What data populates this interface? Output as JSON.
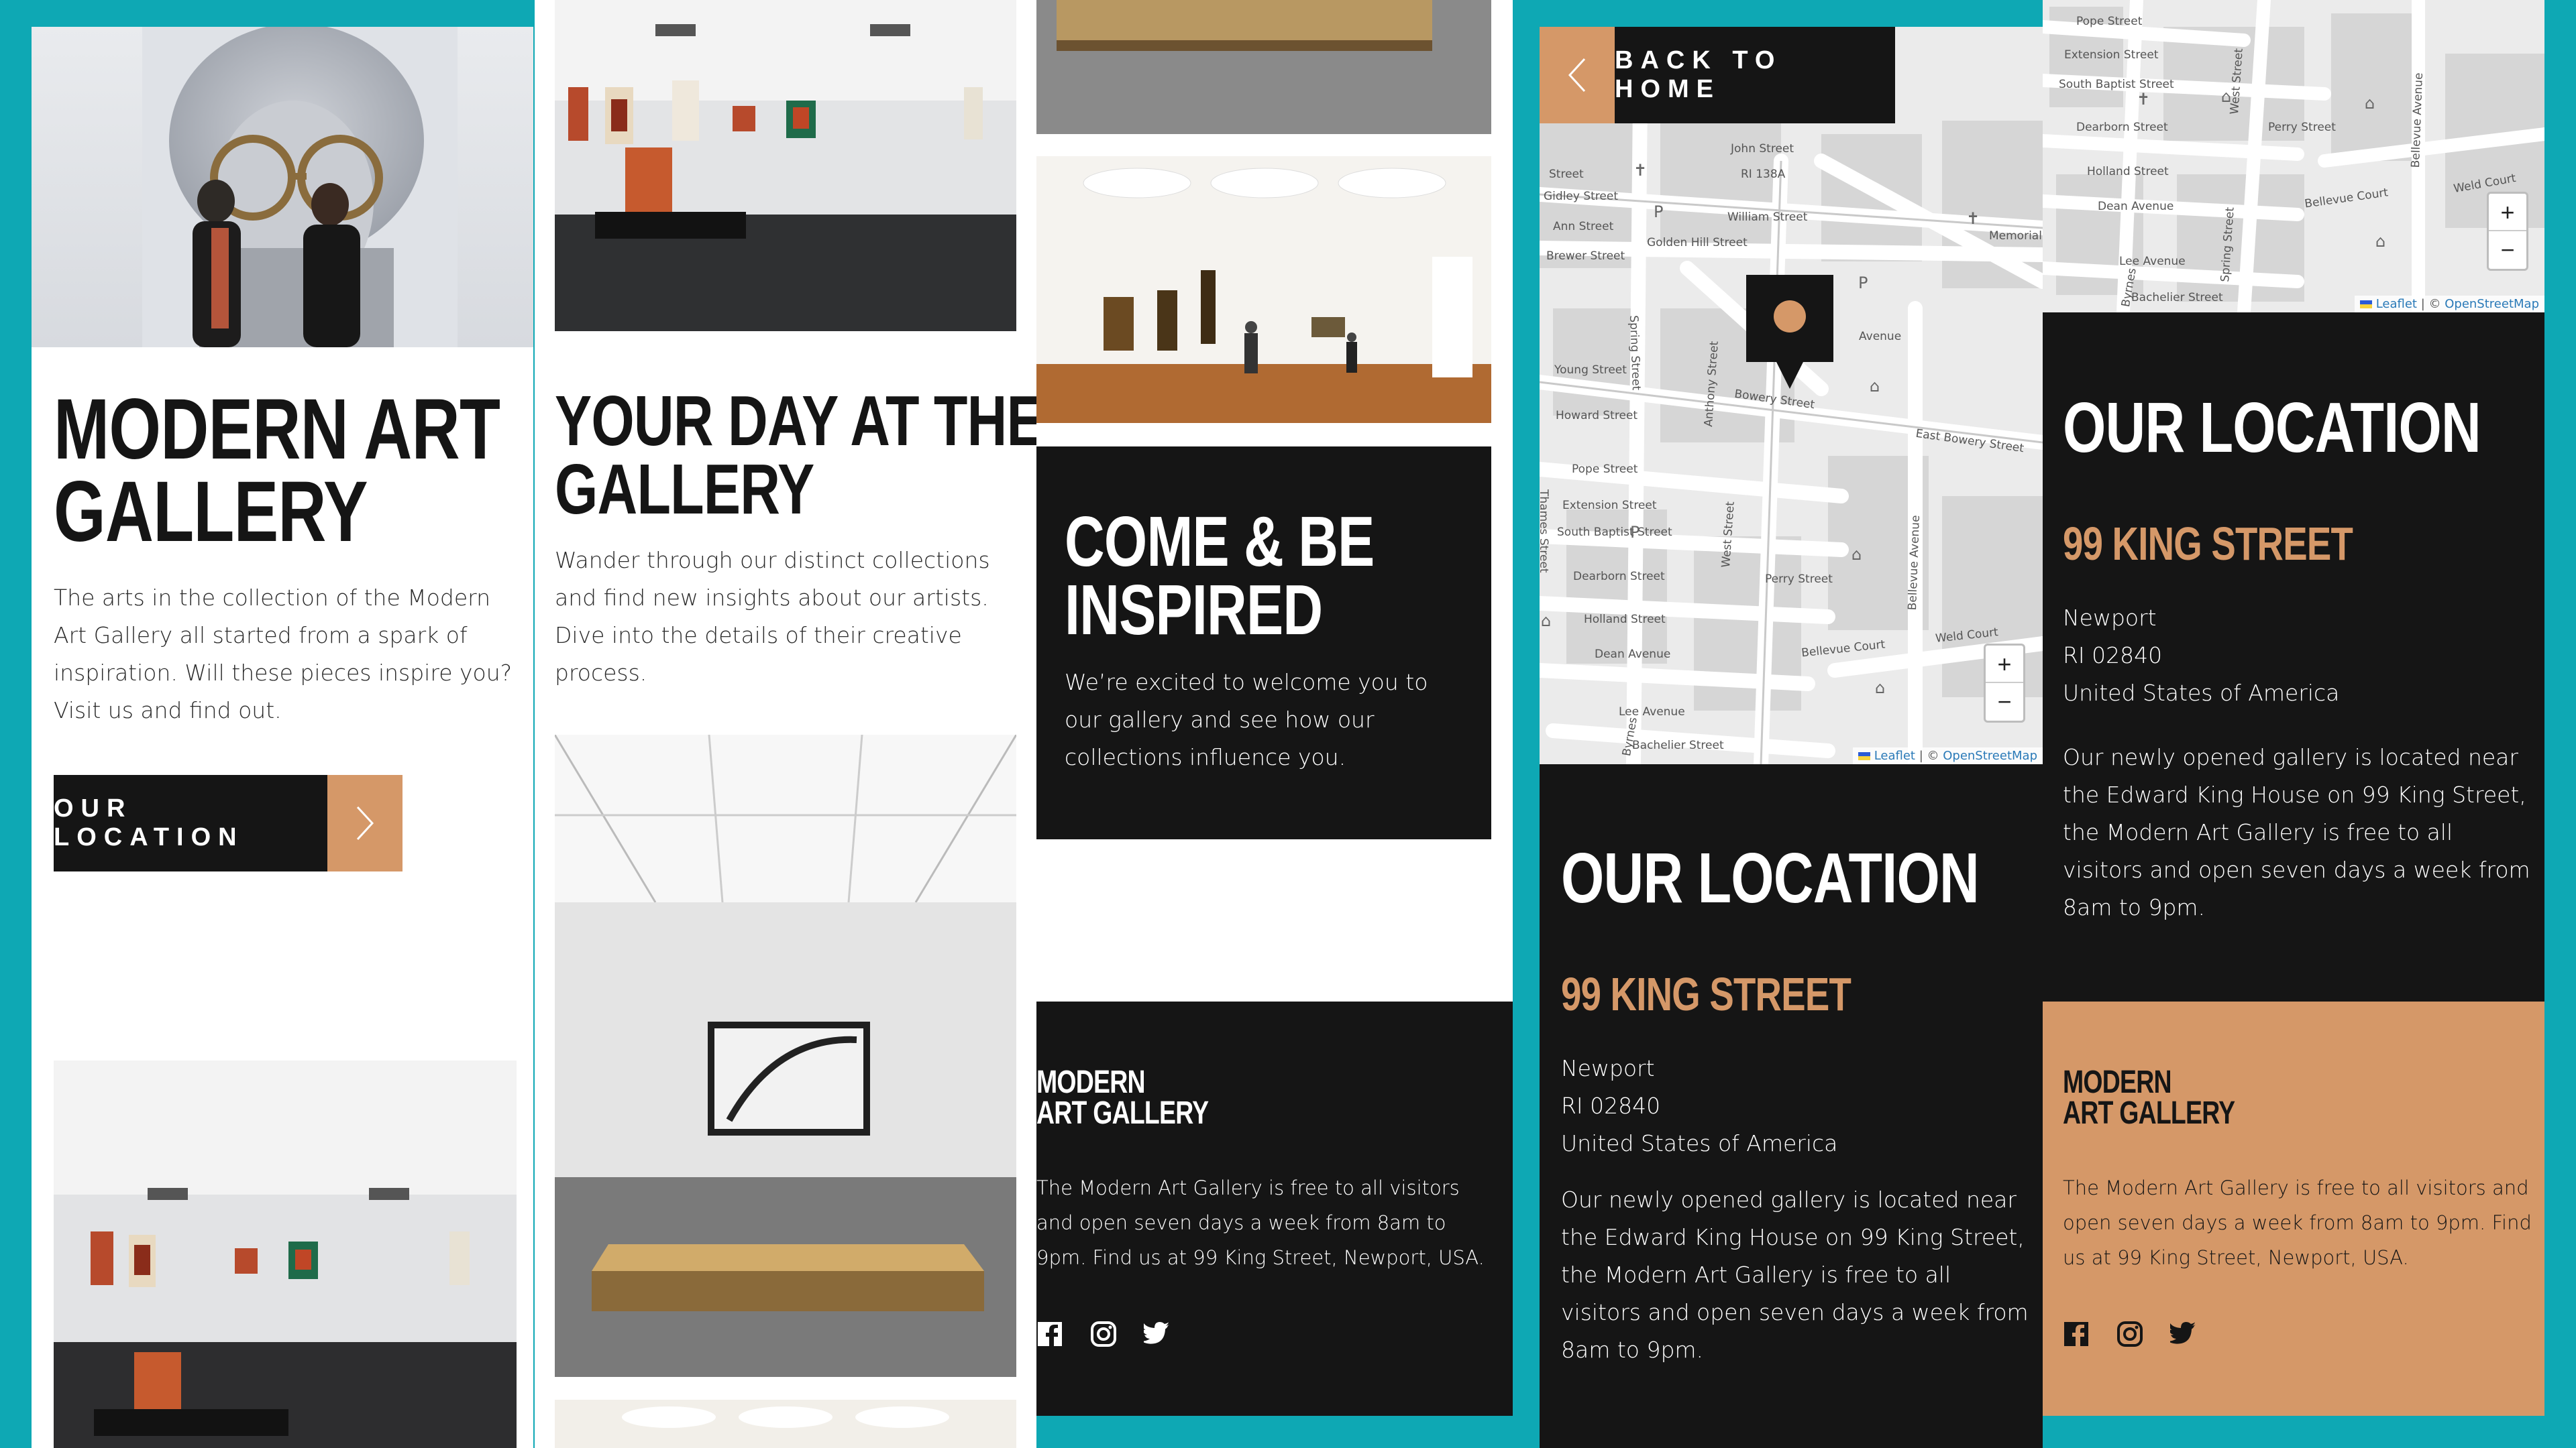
{
  "colors": {
    "background": "#0ea8b4",
    "dark": "#151515",
    "copper": "#d59868",
    "light": "#ffffff"
  },
  "home": {
    "title_line1": "Modern Art",
    "title_line2": "Gallery",
    "intro": "The arts in the collection of the Modern Art Gallery all started from a spark of inspiration. Will these pieces inspire you? Visit us and find out.",
    "button_label": "Our Location"
  },
  "day": {
    "title_line1": "Your day at the",
    "title_line2": "gallery",
    "text": "Wander through our distinct collections and find new insights about our artists. Dive into the details of their creative process."
  },
  "inspired": {
    "title_line1": "Come & be",
    "title_line2": "inspired",
    "text": "We’re excited to welcome you to our gallery and see how our collections influence you."
  },
  "footer": {
    "logo_line1": "Modern",
    "logo_line2": "Art Gallery",
    "text": "The Modern Art Gallery is free to all visitors and open seven days a week from 8am to 9pm. Find us at 99 King Street, Newport, USA.",
    "social_icons": [
      "facebook-icon",
      "instagram-icon",
      "twitter-icon"
    ]
  },
  "location": {
    "back_label": "Back to Home",
    "title": "Our Location",
    "street": "99 King Street",
    "city": "Newport",
    "zip": "RI 02840",
    "country": "United States of America",
    "description": "Our newly opened gallery is located near the Edward King House on 99 King Street, the Modern Art Gallery is free to all visitors and open seven days a week from 8am to 9pm."
  },
  "map": {
    "zoom_in": "+",
    "zoom_out": "−",
    "attribution_leaflet": "Leaflet",
    "attribution_sep": " | © ",
    "attribution_osm": "OpenStreetMap",
    "streets_main": [
      "Street",
      "Gidley Street",
      "Ann Street",
      "Brewer Street",
      "Young Street",
      "Howard Street",
      "Pope Street",
      "Extension Street",
      "South Baptist Street",
      "Dearborn Street",
      "Holland Street",
      "Dean Avenue",
      "Lee Avenue",
      "Bachelier Street",
      "John Street",
      "RI 138A",
      "William Street",
      "Golden Hill Street",
      "Spring Street",
      "Memorial",
      "Bowery Street",
      "East Bowery Street",
      "Anthony Street",
      "West Street",
      "Perry Street",
      "Bellevue Avenue",
      "Bellevue Court",
      "Weld Court",
      "Thames Street",
      "Byrnes",
      "Avenue"
    ],
    "streets_top": [
      "Pope Street",
      "Extension Street",
      "South Baptist Street",
      "Dearborn Street",
      "Holland Street",
      "Dean Avenue",
      "Lee Avenue",
      "Bachelier Street",
      "Perry Street",
      "Bellevue Court",
      "Bellevue Avenue",
      "Spring Street",
      "West Street",
      "Weld Court",
      "Byrnes"
    ]
  }
}
